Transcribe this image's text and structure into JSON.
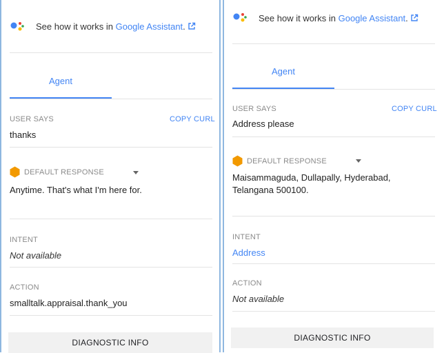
{
  "header": {
    "prefix": "See how it works in ",
    "link_text": "Google Assistant",
    "suffix": "."
  },
  "tab": {
    "label": "Agent"
  },
  "labels": {
    "user_says": "USER SAYS",
    "copy_curl": "COPY CURL",
    "default_response": "DEFAULT RESPONSE",
    "intent": "INTENT",
    "action": "ACTION",
    "diagnostic_info": "DIAGNOSTIC INFO"
  },
  "left": {
    "user_says": "thanks",
    "response": "Anytime. That's what I'm here for.",
    "intent": "Not available",
    "action": "smalltalk.appraisal.thank_you"
  },
  "right": {
    "user_says": "Address please",
    "response_line1": "Maisammaguda, Dullapally, Hyderabad,",
    "response_line2": "Telangana 500100.",
    "intent": "Address",
    "action": "Not available"
  },
  "colors": {
    "accent": "#4285f4",
    "response_icon": "#f29900",
    "dots": [
      "#4285f4",
      "#ea4335",
      "#fbbc04",
      "#34a853"
    ]
  }
}
